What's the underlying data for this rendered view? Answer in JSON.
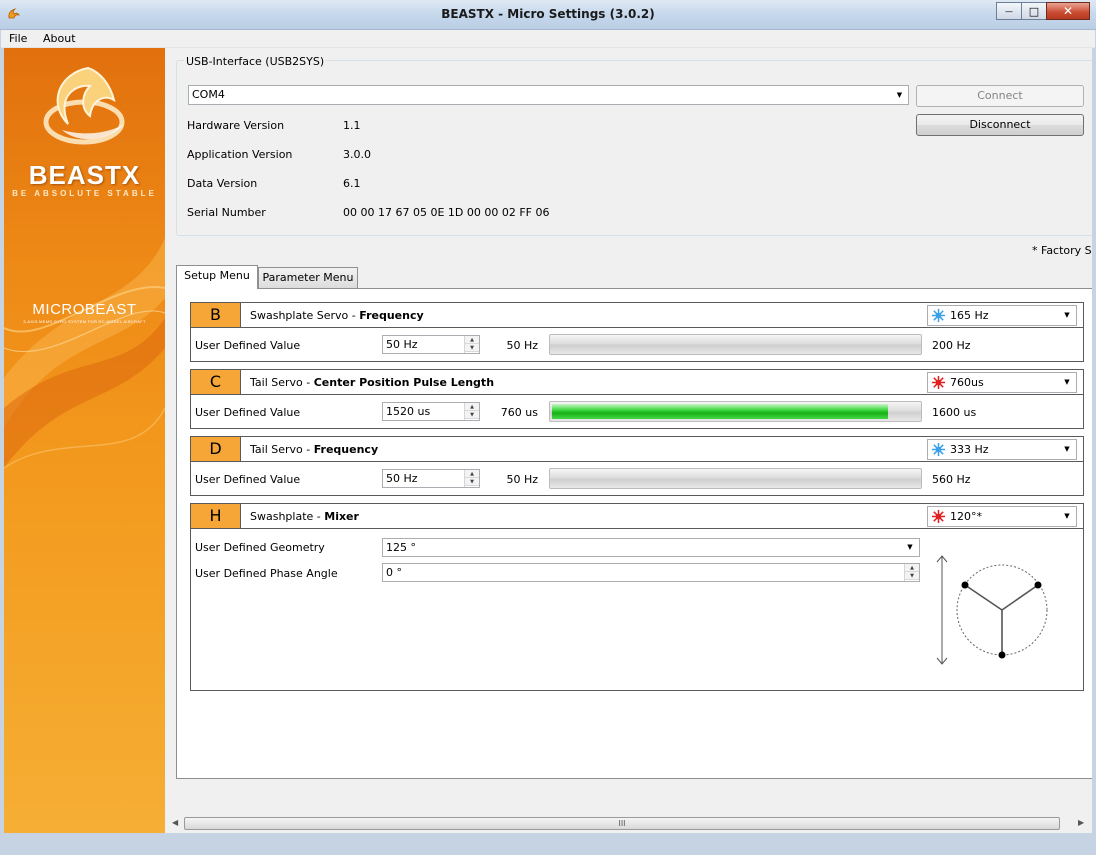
{
  "window": {
    "title": "BEASTX - Micro Settings (3.0.2)",
    "minimize_glyph": "—",
    "maximize_glyph": "□",
    "close_glyph": "✕"
  },
  "menu": {
    "file": "File",
    "about": "About"
  },
  "banner": {
    "brand": "BEASTX",
    "tagline": "BE ABSOLUTE STABLE",
    "product": "MICROBEAST",
    "product_sub": "3-AXIS MEMS GYRO SYSTEM FOR RC-MODEL AIRCRAFT"
  },
  "usb": {
    "legend": "USB-Interface (USB2SYS)",
    "port": "COM4",
    "connect_label": "Connect",
    "disconnect_label": "Disconnect",
    "info": [
      {
        "label": "Hardware Version",
        "value": "1.1"
      },
      {
        "label": "Application Version",
        "value": "3.0.0"
      },
      {
        "label": "Data Version",
        "value": "6.1"
      },
      {
        "label": "Serial Number",
        "value": "00 00 17 67 05 0E 1D 00 00 02 FF 06"
      }
    ]
  },
  "factory_note": "* Factory Se",
  "tabs": {
    "setup": "Setup Menu",
    "parameter": "Parameter Menu"
  },
  "sections": {
    "b": {
      "letter": "B",
      "title_plain": "Swashplate Servo - ",
      "title_bold": "Frequency",
      "preset": "165 Hz",
      "preset_color": "#3aa0e8",
      "row_label": "User Defined Value",
      "value": "50 Hz",
      "min": "50 Hz",
      "max": "200 Hz",
      "progress": 0
    },
    "c": {
      "letter": "C",
      "title_plain": "Tail Servo - ",
      "title_bold": "Center Position Pulse Length",
      "preset": "760us",
      "preset_color": "#e02020",
      "row_label": "User Defined Value",
      "value": "1520 us",
      "min": "760 us",
      "max": "1600 us",
      "progress": 0.905
    },
    "d": {
      "letter": "D",
      "title_plain": "Tail Servo - ",
      "title_bold": "Frequency",
      "preset": "333 Hz",
      "preset_color": "#3aa0e8",
      "row_label": "User Defined Value",
      "value": "50 Hz",
      "min": "50 Hz",
      "max": "560 Hz",
      "progress": 0
    },
    "h": {
      "letter": "H",
      "title_plain": "Swashplate - ",
      "title_bold": "Mixer",
      "preset": "120°*",
      "preset_color": "#e02020",
      "geometry_label": "User Defined Geometry",
      "geometry_value": "125 °",
      "phase_label": "User Defined Phase Angle",
      "phase_value": "0 °"
    }
  },
  "scrollbar": {
    "grip": "III"
  }
}
